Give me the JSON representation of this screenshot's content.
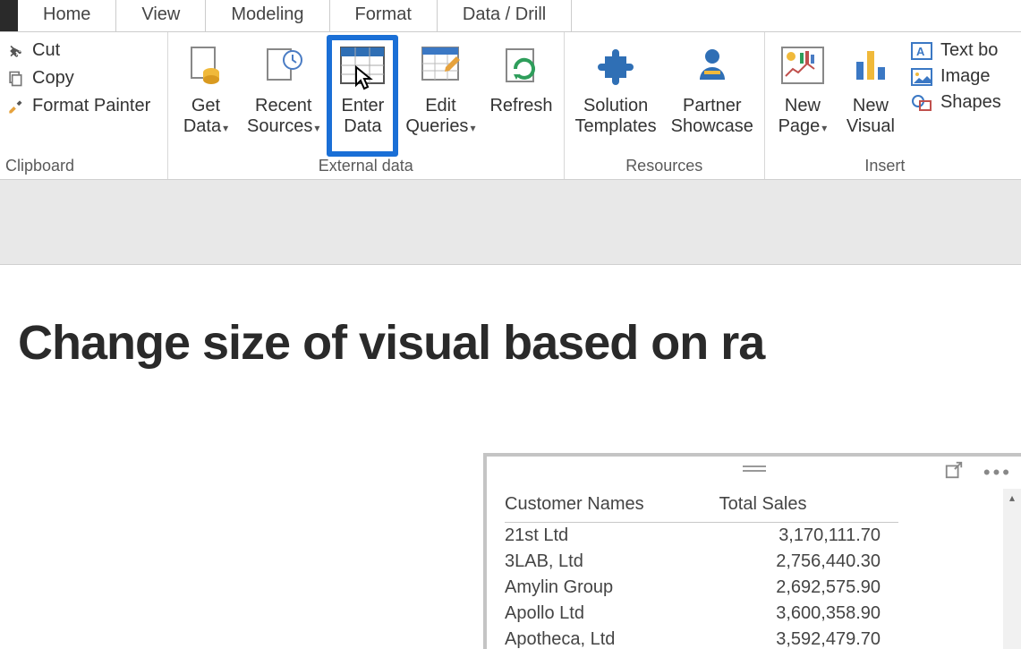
{
  "tabs": [
    "Home",
    "View",
    "Modeling",
    "Format",
    "Data / Drill"
  ],
  "clipboard": {
    "cut": "Cut",
    "copy": "Copy",
    "format_painter": "Format Painter",
    "group_label": "Clipboard"
  },
  "external_data": {
    "get_data": "Get\nData",
    "recent_sources": "Recent\nSources",
    "enter_data": "Enter\nData",
    "edit_queries": "Edit\nQueries",
    "refresh": "Refresh",
    "group_label": "External data"
  },
  "resources": {
    "solution_templates": "Solution\nTemplates",
    "partner_showcase": "Partner\nShowcase",
    "group_label": "Resources"
  },
  "insert": {
    "new_page": "New\nPage",
    "new_visual": "New\nVisual",
    "text_box": "Text bo",
    "image": "Image",
    "shapes": "Shapes",
    "group_label": "Insert"
  },
  "canvas": {
    "title": "Change size of visual based on ra"
  },
  "table": {
    "columns": [
      "Customer Names",
      "Total Sales"
    ],
    "rows": [
      {
        "name": "21st Ltd",
        "sales": "3,170,111.70"
      },
      {
        "name": "3LAB, Ltd",
        "sales": "2,756,440.30"
      },
      {
        "name": "Amylin Group",
        "sales": "2,692,575.90"
      },
      {
        "name": "Apollo Ltd",
        "sales": "3,600,358.90"
      },
      {
        "name": "Apotheca, Ltd",
        "sales": "3,592,479.70"
      }
    ]
  }
}
